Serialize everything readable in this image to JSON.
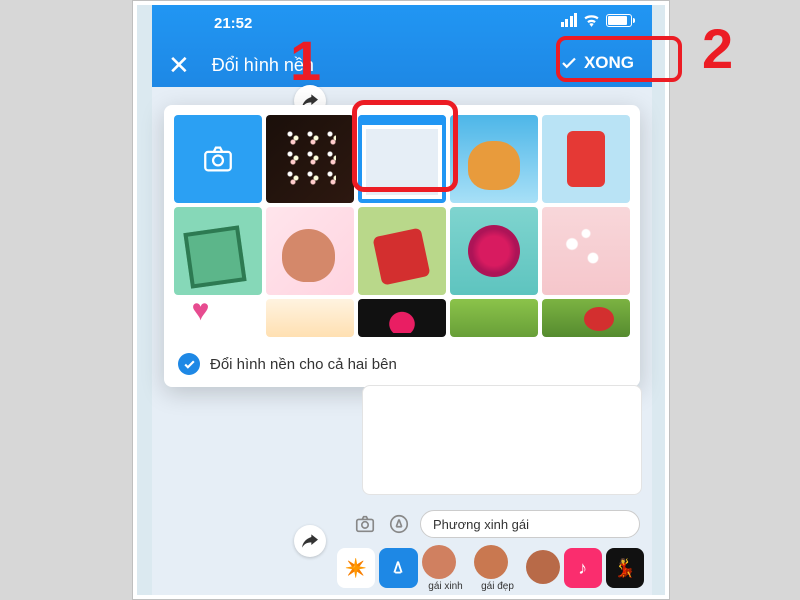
{
  "status": {
    "time": "21:52"
  },
  "nav": {
    "title": "Đổi hình nền",
    "done": "XONG"
  },
  "popup": {
    "both_sides_label": "Đổi hình nền cho cả hai bên"
  },
  "input": {
    "text": "Phương xinh gái"
  },
  "suggestions": {
    "item1": "gái xinh",
    "item2": "gái đẹp"
  },
  "annotations": {
    "num1": "1",
    "num2": "2"
  }
}
